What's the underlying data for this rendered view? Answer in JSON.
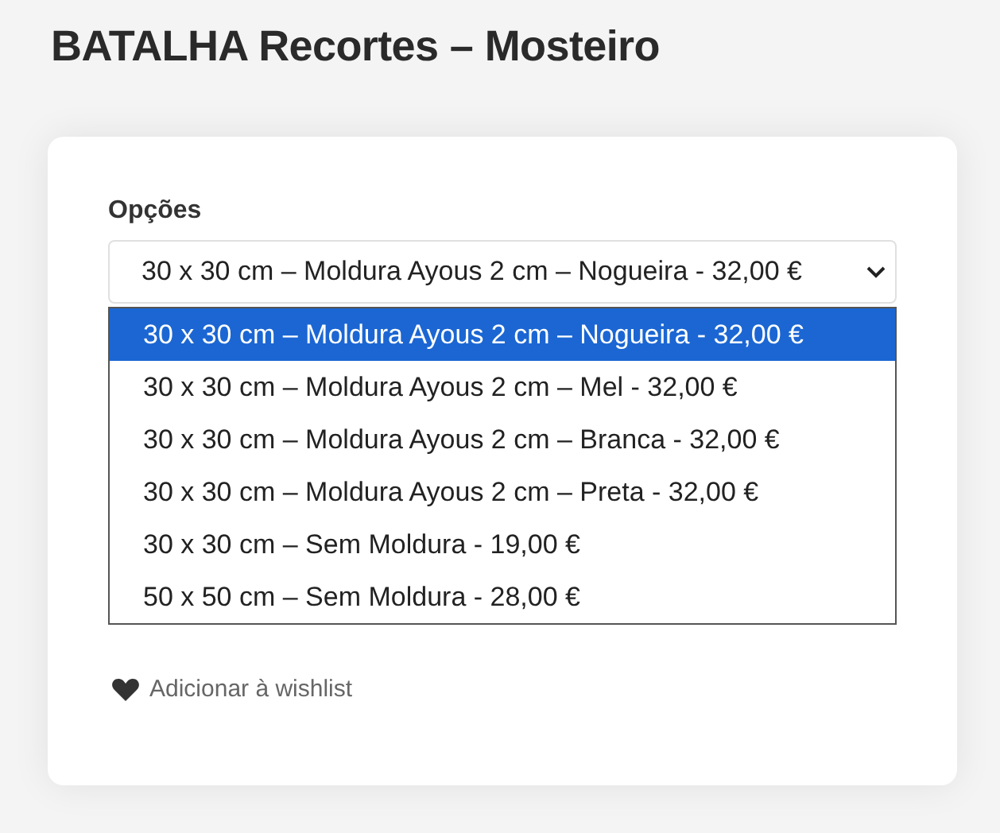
{
  "page_title": "BATALHA Recortes – Mosteiro",
  "options_field": {
    "label": "Opções",
    "value": "30 x 30 cm – Moldura Ayous 2 cm – Nogueira - 32,00 €",
    "expanded": true,
    "options": [
      {
        "label": "30 x 30 cm – Moldura Ayous 2 cm – Nogueira - 32,00 €",
        "selected": true
      },
      {
        "label": "30 x 30 cm – Moldura Ayous 2 cm – Mel - 32,00 €",
        "selected": false
      },
      {
        "label": "30 x 30 cm – Moldura Ayous 2 cm – Branca - 32,00 €",
        "selected": false
      },
      {
        "label": "30 x 30 cm – Moldura Ayous 2 cm – Preta - 32,00 €",
        "selected": false
      },
      {
        "label": "30 x 30 cm – Sem Moldura - 19,00 €",
        "selected": false
      },
      {
        "label": "50 x 50 cm – Sem Moldura - 28,00 €",
        "selected": false
      }
    ]
  },
  "wishlist_link": "Adicionar à wishlist"
}
